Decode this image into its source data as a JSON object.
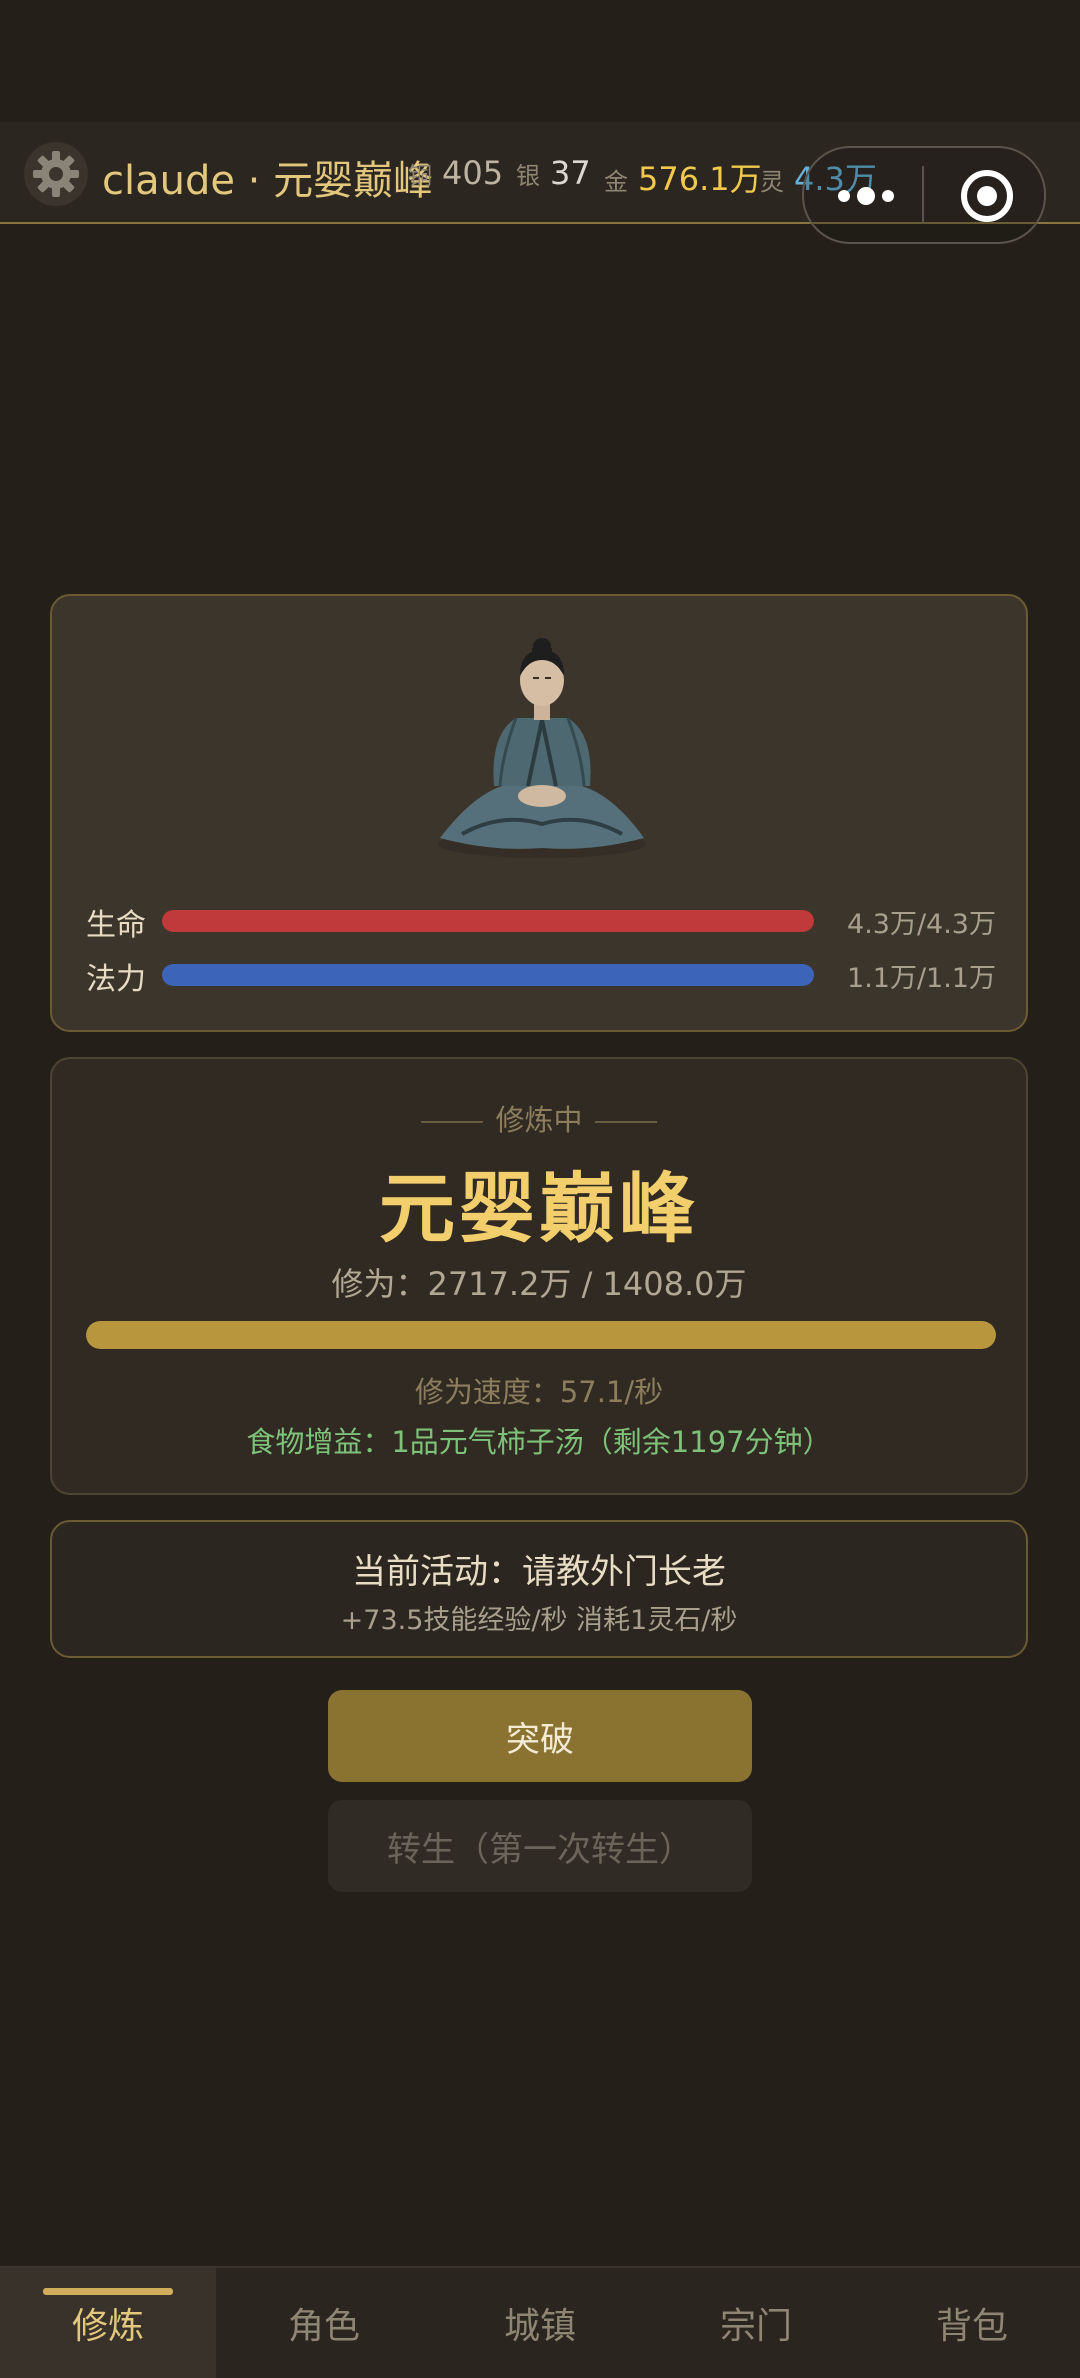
{
  "header": {
    "title": "claude · 元婴巅峰",
    "currencies": [
      {
        "key": "铜",
        "value": "405",
        "color": "#bdb3a0"
      },
      {
        "key": "银",
        "value": "37",
        "color": "#dcd8d0"
      },
      {
        "key": "金",
        "value": "576.1万",
        "color": "#f2c94c"
      },
      {
        "key": "灵",
        "value": "4.3万",
        "color": "#62b4de"
      }
    ]
  },
  "character": {
    "hp_label": "生命",
    "hp_value": "4.3万/4.3万",
    "hp_fraction": 1.0,
    "hp_color": "#c0393b",
    "mp_label": "法力",
    "mp_value": "1.1万/1.1万",
    "mp_fraction": 1.0,
    "mp_color": "#3c64b8"
  },
  "cultivation": {
    "status": "修炼中",
    "realm": "元婴巅峰",
    "xiuwei_text": "修为：2717.2万 / 1408.0万",
    "progress_fraction": 1.0,
    "speed_text": "修为速度：57.1/秒",
    "food_text": "食物增益：1品元气柿子汤（剩余1197分钟）"
  },
  "activity": {
    "title": "当前活动：请教外门长老",
    "detail": "+73.5技能经验/秒  消耗1灵石/秒"
  },
  "buttons": {
    "breakthrough": "突破",
    "rebirth": "转生（第一次转生）"
  },
  "nav": {
    "items": [
      {
        "label": "修炼",
        "active": true
      },
      {
        "label": "角色",
        "active": false
      },
      {
        "label": "城镇",
        "active": false
      },
      {
        "label": "宗门",
        "active": false
      },
      {
        "label": "背包",
        "active": false
      }
    ]
  },
  "icons": [
    "gear-icon",
    "more-dots-icon",
    "target-close-icon",
    "meditating-cultivator-image"
  ]
}
